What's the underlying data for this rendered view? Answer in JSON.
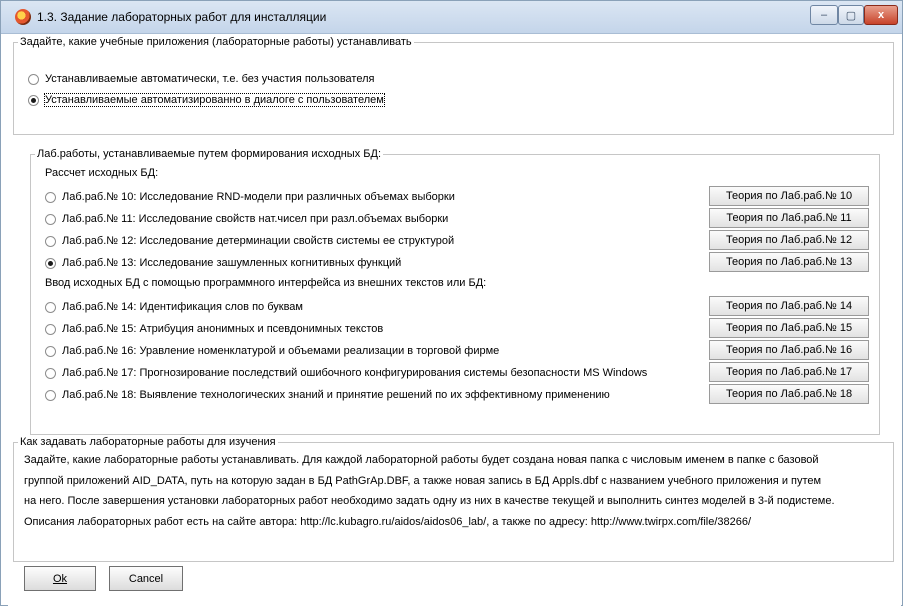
{
  "window": {
    "title": "1.3. Задание лабораторных работ для инсталляции",
    "min_symbol": "–",
    "max_symbol": "▢",
    "close_symbol": "x"
  },
  "mode_group": {
    "legend": "Задайте, какие учебные приложения (лабораторные работы) устанавливать",
    "options": [
      {
        "label": "Устанавливаемые автоматически, т.е. без участия пользователя",
        "checked": false
      },
      {
        "label": "Устанавливаемые автоматизированно в диалоге с пользователем",
        "checked": true
      }
    ]
  },
  "labs_group": {
    "legend": "Лаб.работы, устанавливаемые путем формирования исходных БД:",
    "section1_title": "Рассчет исходных БД:",
    "section2_title": "Ввод исходных БД с помощью программного интерфейса из внешних текстов или БД:",
    "labs": [
      {
        "label": "Лаб.раб.№ 10: Исследование RND-модели при различных объемах выборки",
        "checked": false,
        "button": "Теория по Лаб.раб.№ 10"
      },
      {
        "label": "Лаб.раб.№ 11: Исследование свойств нат.чисел при разл.объемах выборки",
        "checked": false,
        "button": "Теория по Лаб.раб.№ 11"
      },
      {
        "label": "Лаб.раб.№ 12: Исследование детерминации свойств системы ее структурой",
        "checked": false,
        "button": "Теория по Лаб.раб.№ 12"
      },
      {
        "label": "Лаб.раб.№ 13: Исследование зашумленных когнитивных функций",
        "checked": true,
        "button": "Теория по Лаб.раб.№ 13"
      },
      {
        "label": "Лаб.раб.№ 14: Идентификация слов по буквам",
        "checked": false,
        "button": "Теория по Лаб.раб.№ 14"
      },
      {
        "label": "Лаб.раб.№ 15: Атрибуция анонимных и псевдонимных текстов",
        "checked": false,
        "button": "Теория по Лаб.раб.№ 15"
      },
      {
        "label": "Лаб.раб.№ 16: Уравление номенклатурой и объемами реализации в торговой фирме",
        "checked": false,
        "button": "Теория по Лаб.раб.№ 16"
      },
      {
        "label": "Лаб.раб.№ 17: Прогнозирование последствий ошибочного конфигурирования системы безопасности MS Windows",
        "checked": false,
        "button": "Теория по Лаб.раб.№ 17"
      },
      {
        "label": "Лаб.раб.№ 18: Выявление технологических знаний и принятие решений по их эффективному применению",
        "checked": false,
        "button": "Теория по Лаб.раб.№ 18"
      }
    ]
  },
  "help_group": {
    "legend": "Как задавать лабораторные работы для изучения",
    "lines": [
      "Задайте, какие лабораторные работы устанавливать. Для каждой лабораторной работы будет создана новая папка с числовым именем в папке с базовой",
      "группой приложений AID_DATA, путь на которую задан в БД PathGrAp.DBF, а также новая запись в БД Appls.dbf с названием учебного приложения и путем",
      "на него. После завершения установки лабораторных работ необходимо задать одну из них в качестве текущей и выполнить синтез моделей в 3-й подистеме.",
      "Описания лабораторных работ есть на сайте автора: http://lc.kubagro.ru/aidos/aidos06_lab/, а также по адресу: http://www.twirpx.com/file/38266/"
    ]
  },
  "buttons": {
    "ok_label": "Ok",
    "cancel_label": "Cancel"
  }
}
